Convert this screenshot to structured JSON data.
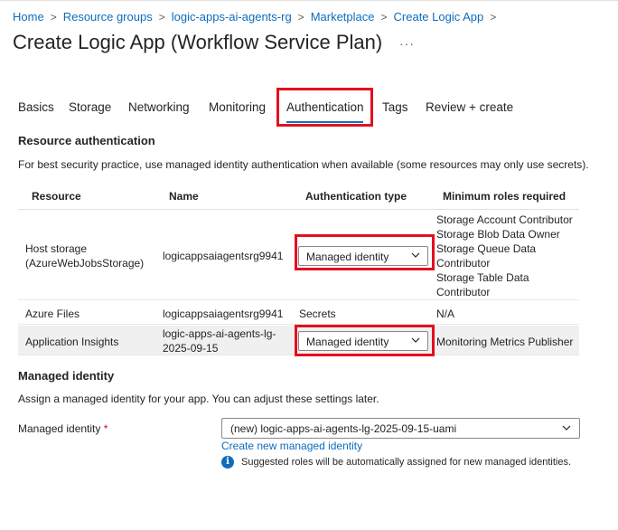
{
  "breadcrumb": {
    "items": [
      "Home",
      "Resource groups",
      "logic-apps-ai-agents-rg",
      "Marketplace",
      "Create Logic App"
    ]
  },
  "page": {
    "title": "Create Logic App (Workflow Service Plan)",
    "more": "···"
  },
  "tabs": [
    {
      "label": "Basics"
    },
    {
      "label": "Storage"
    },
    {
      "label": "Networking"
    },
    {
      "label": "Monitoring"
    },
    {
      "label": "Authentication",
      "active": true
    },
    {
      "label": "Tags"
    },
    {
      "label": "Review + create"
    }
  ],
  "resource_auth": {
    "heading": "Resource authentication",
    "description": "For best security practice, use managed identity authentication when available (some resources may only use secrets).",
    "columns": [
      "Resource",
      "Name",
      "Authentication type",
      "Minimum roles required"
    ],
    "rows": [
      {
        "resource": "Host storage (AzureWebJobsStorage)",
        "name": "logicappsaiagentsrg9941",
        "auth_type": "Managed identity",
        "roles": [
          "Storage Account Contributor",
          "Storage Blob Data Owner",
          "Storage Queue Data",
          "Contributor",
          "Storage Table Data",
          "Contributor"
        ]
      },
      {
        "resource": "Azure Files",
        "name": "logicappsaiagentsrg9941",
        "auth_type": "Secrets",
        "roles": [
          "N/A"
        ]
      },
      {
        "resource": "Application Insights",
        "name": "logic-apps-ai-agents-lg-2025-09-15",
        "auth_type": "Managed identity",
        "roles": [
          "Monitoring Metrics Publisher"
        ]
      }
    ]
  },
  "managed_identity": {
    "heading": "Managed identity",
    "description": "Assign a managed identity for your app. You can adjust these settings later.",
    "field_label": "Managed identity",
    "required_mark": "*",
    "selected_value": "(new) logic-apps-ai-agents-lg-2025-09-15-uami",
    "create_link": "Create new managed identity",
    "info_text": "Suggested roles will be automatically assigned for new managed identities."
  },
  "colors": {
    "link": "#0f6cbd",
    "highlight_box": "#e3101e",
    "required": "#c50f1f"
  }
}
